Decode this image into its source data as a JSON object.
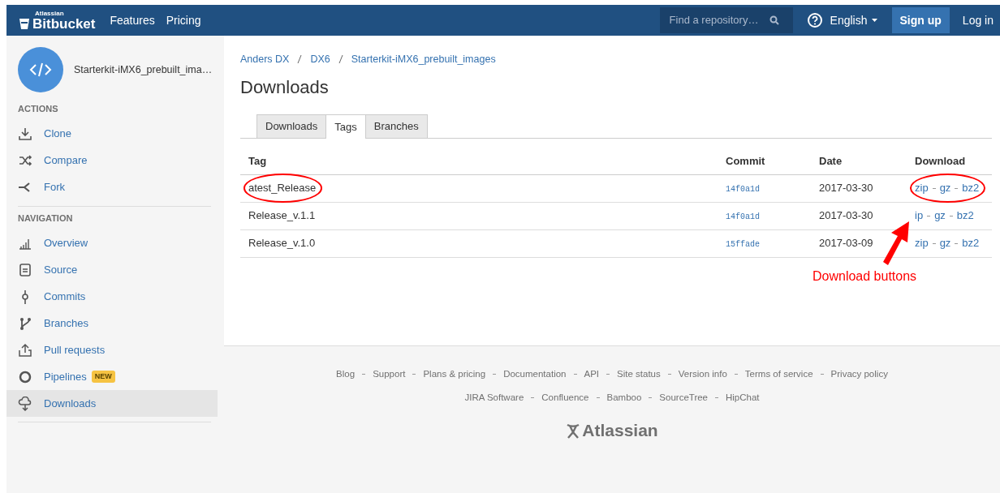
{
  "navbar": {
    "logo_caption": "Atlassian",
    "logo": "Bitbucket",
    "links": [
      "Features",
      "Pricing"
    ],
    "search": {
      "placeholder": "Find a repository…"
    },
    "language": "English",
    "sign_up": "Sign up",
    "log_in": "Log in"
  },
  "sidebar": {
    "repo_name": "Starterkit-iMX6_prebuilt_ima…",
    "sections": [
      {
        "title": "ACTIONS",
        "items": [
          {
            "label": "Clone",
            "selected": false
          },
          {
            "label": "Compare",
            "selected": false
          },
          {
            "label": "Fork",
            "selected": false
          }
        ]
      },
      {
        "title": "NAVIGATION",
        "items": [
          {
            "label": "Overview",
            "selected": false
          },
          {
            "label": "Source",
            "selected": false
          },
          {
            "label": "Commits",
            "selected": false
          },
          {
            "label": "Branches",
            "selected": false
          },
          {
            "label": "Pull requests",
            "selected": false
          },
          {
            "label": "Pipelines",
            "badge": "NEW",
            "selected": false
          },
          {
            "label": "Downloads",
            "selected": true
          }
        ]
      }
    ]
  },
  "breadcrumb": [
    "Anders DX",
    "DX6",
    "Starterkit-iMX6_prebuilt_images"
  ],
  "title": "Downloads",
  "tabs": [
    {
      "label": "Downloads",
      "selected": false
    },
    {
      "label": "Tags",
      "selected": true
    },
    {
      "label": "Branches",
      "selected": false
    }
  ],
  "table": {
    "columns": [
      "Tag",
      "Commit",
      "Date",
      "Download"
    ],
    "rows": [
      {
        "tag": "atest_Release",
        "commit": "14f0a1d",
        "date": "2017-03-30",
        "downloads": [
          "zip",
          "gz",
          "bz2"
        ],
        "tag_circled": true,
        "downloads_circled": true
      },
      {
        "tag": "Release_v.1.1",
        "commit": "14f0a1d",
        "date": "2017-03-30",
        "downloads": [
          "ip",
          "gz",
          "bz2"
        ],
        "tag_circled": false,
        "downloads_circled": false
      },
      {
        "tag": "Release_v.1.0",
        "commit": "15ffade",
        "date": "2017-03-09",
        "downloads": [
          "zip",
          "gz",
          "bz2"
        ],
        "tag_circled": false,
        "downloads_circled": false
      }
    ]
  },
  "callout": {
    "text": "Download buttons",
    "color": "#ff0000"
  },
  "footer": {
    "links": [
      "Blog",
      "Support",
      "Plans & pricing",
      "Documentation",
      "API",
      "Site status",
      "Version info",
      "Terms of service",
      "Privacy policy"
    ],
    "products": [
      "JIRA Software",
      "Confluence",
      "Bamboo",
      "SourceTree",
      "HipChat"
    ],
    "brand": "Atlassian"
  }
}
